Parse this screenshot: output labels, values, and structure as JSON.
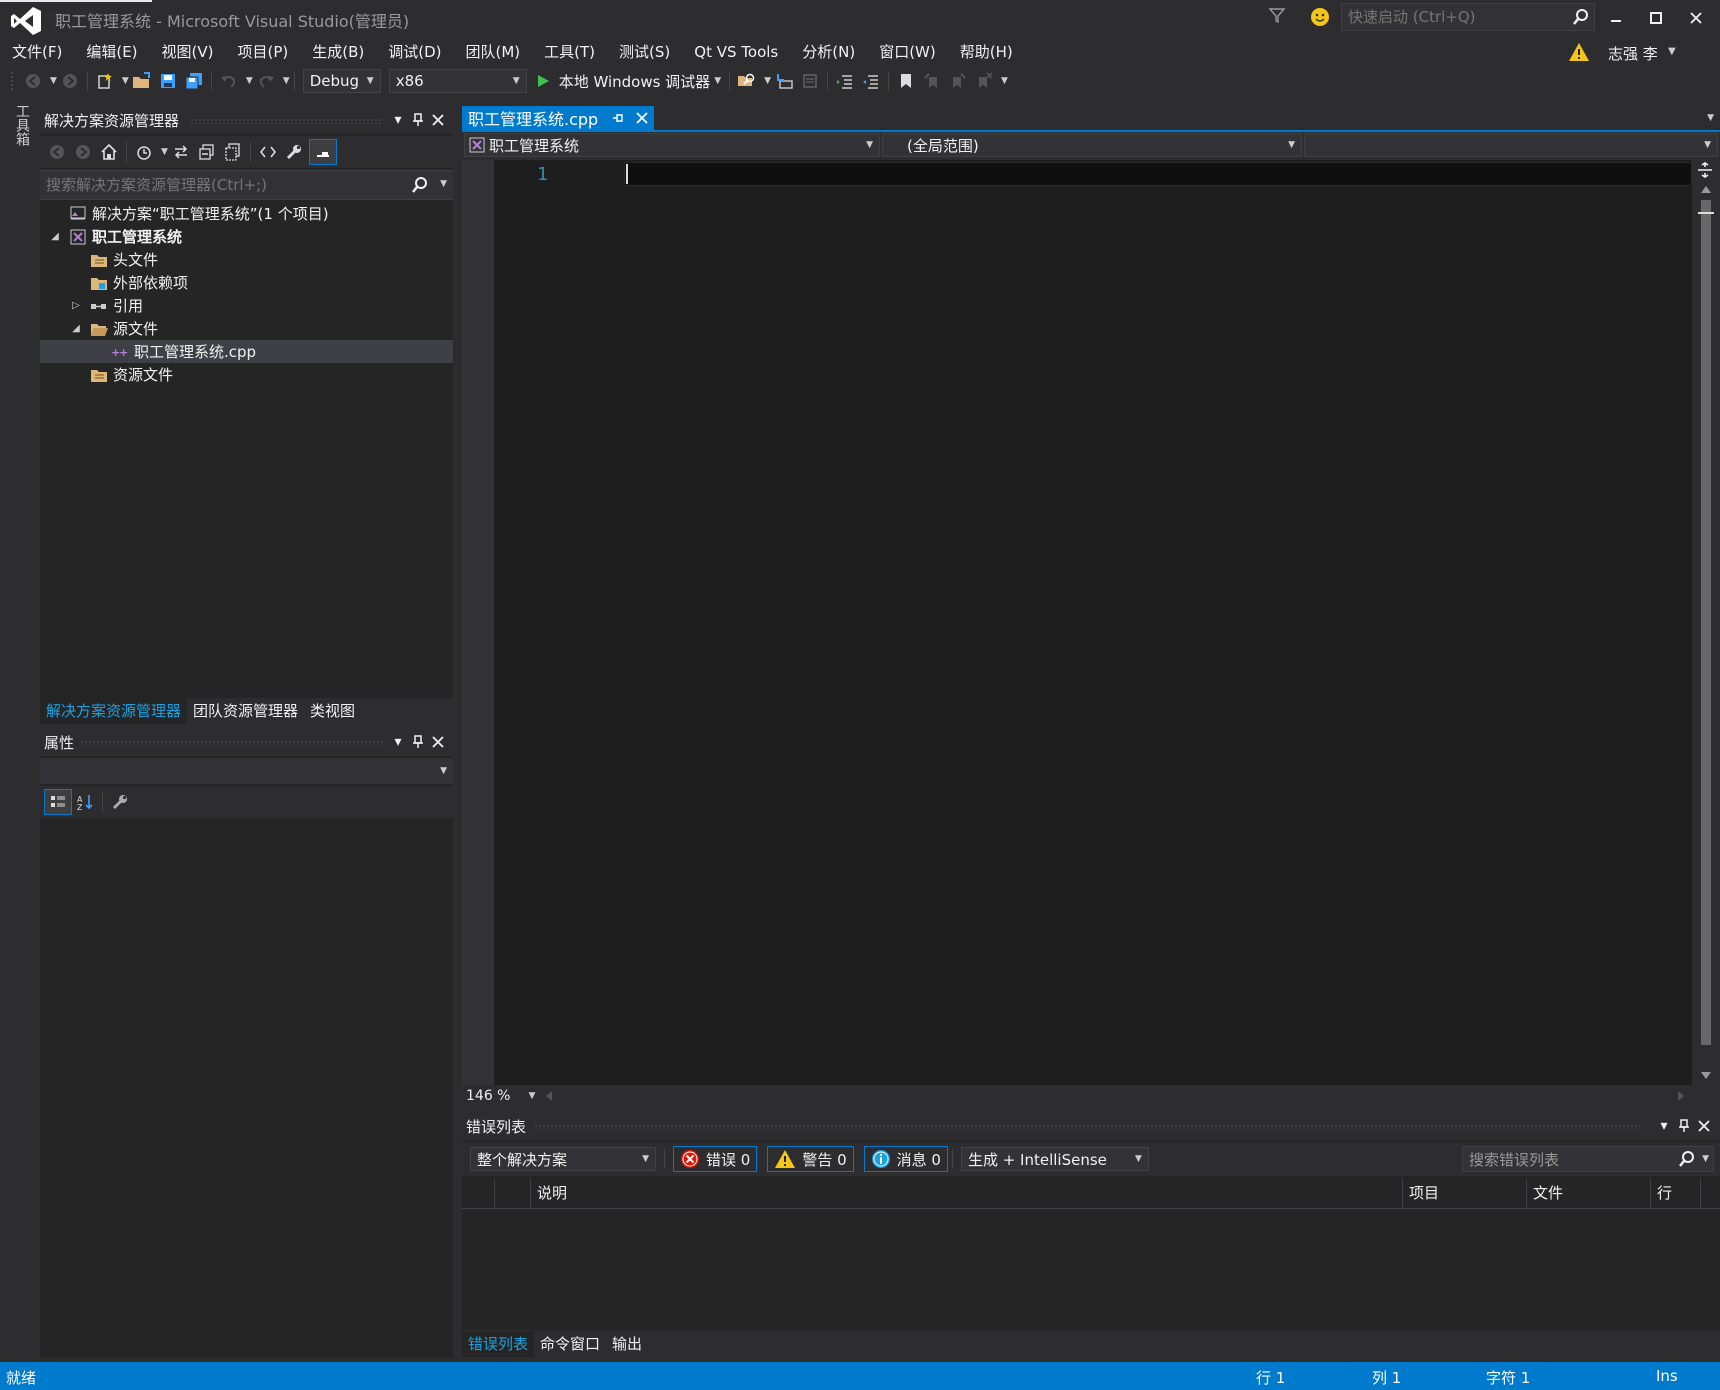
{
  "window": {
    "title": "职工管理系统 - Microsoft Visual Studio(管理员)",
    "quick_launch_placeholder": "快速启动 (Ctrl+Q)"
  },
  "menu": [
    "文件(F)",
    "编辑(E)",
    "视图(V)",
    "项目(P)",
    "生成(B)",
    "调试(D)",
    "团队(M)",
    "工具(T)",
    "测试(S)",
    "Qt VS Tools",
    "分析(N)",
    "窗口(W)",
    "帮助(H)"
  ],
  "user": {
    "name": "志强 李"
  },
  "toolbar": {
    "configuration": "Debug",
    "platform": "x86",
    "debugger_label": "本地 Windows 调试器"
  },
  "toolbox": {
    "label": "工具箱"
  },
  "solution_explorer": {
    "title": "解决方案资源管理器",
    "search_placeholder": "搜索解决方案资源管理器(Ctrl+;)",
    "tree": [
      {
        "label": "解决方案“职工管理系统”(1 个项目)",
        "indent": 0,
        "expander": "",
        "icon": "solution-icon",
        "bold": false,
        "selected": false
      },
      {
        "label": "职工管理系统",
        "indent": 0,
        "expander": "◢",
        "icon": "cpp-project-icon",
        "bold": true,
        "selected": false
      },
      {
        "label": "头文件",
        "indent": 1,
        "expander": "",
        "icon": "filter-folder-icon",
        "bold": false,
        "selected": false
      },
      {
        "label": "外部依赖项",
        "indent": 1,
        "expander": "",
        "icon": "external-deps-icon",
        "bold": false,
        "selected": false
      },
      {
        "label": "引用",
        "indent": 1,
        "expander": "▷",
        "icon": "references-icon",
        "bold": false,
        "selected": false
      },
      {
        "label": "源文件",
        "indent": 1,
        "expander": "◢",
        "icon": "filter-folder-open-icon",
        "bold": false,
        "selected": false
      },
      {
        "label": "职工管理系统.cpp",
        "indent": 2,
        "expander": "",
        "icon": "cpp-file-icon",
        "bold": false,
        "selected": true
      },
      {
        "label": "资源文件",
        "indent": 1,
        "expander": "",
        "icon": "filter-folder-icon",
        "bold": false,
        "selected": false
      }
    ],
    "bottom_tabs": [
      "解决方案资源管理器",
      "团队资源管理器",
      "类视图"
    ]
  },
  "properties": {
    "title": "属性"
  },
  "editor": {
    "tab_label": "职工管理系统.cpp",
    "nav_project": "职工管理系统",
    "nav_scope": "(全局范围)",
    "line_number": "1",
    "zoom": "146 %"
  },
  "error_list": {
    "title": "错误列表",
    "scope": "整个解决方案",
    "errors_label": "错误 0",
    "warnings_label": "警告 0",
    "messages_label": "消息 0",
    "build_filter": "生成 + IntelliSense",
    "search_placeholder": "搜索错误列表",
    "columns": [
      "说明",
      "项目",
      "文件",
      "行"
    ],
    "bottom_tabs": [
      "错误列表",
      "命令窗口",
      "输出"
    ]
  },
  "status_bar": {
    "status": "就绪",
    "row": "行 1",
    "col": "列 1",
    "char": "字符 1",
    "mode": "Ins"
  },
  "colors": {
    "accent": "#007acc",
    "background": "#2d2d30",
    "editor_bg": "#1e1e1e",
    "line_number": "#2b91af"
  }
}
